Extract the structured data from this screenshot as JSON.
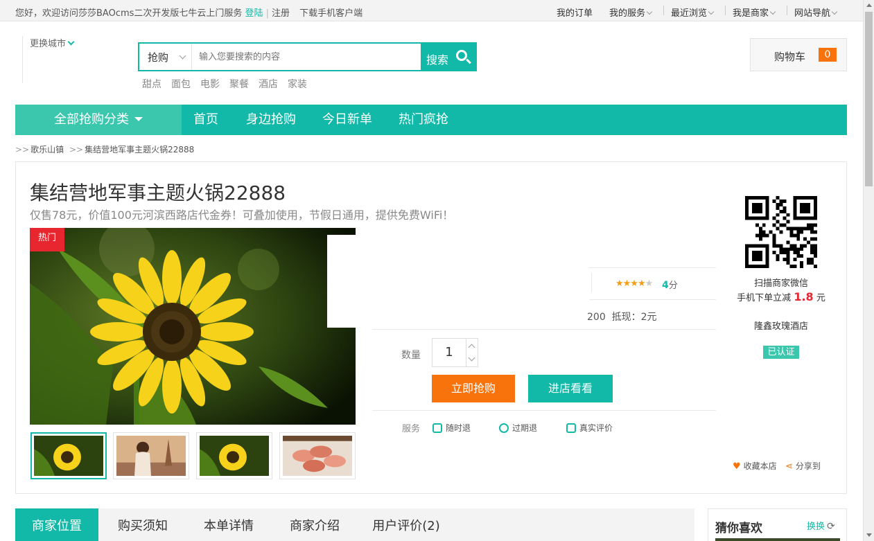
{
  "topbar": {
    "greeting": "您好，欢迎访问莎莎BAOcms二次开发版七牛云上门服务",
    "login": "登陆",
    "register": "注册",
    "download": "下载手机客户端",
    "my_orders": "我的订单",
    "my_services": "我的服务",
    "recent": "最近浏览",
    "merchant": "我是商家",
    "site_nav": "网站导航"
  },
  "header": {
    "change_city": "更换城市",
    "search_type": "抢购",
    "search_placeholder": "输入您要搜索的内容",
    "search_button": "搜索",
    "hot_words": [
      "甜点",
      "面包",
      "电影",
      "聚餐",
      "酒店",
      "家装"
    ],
    "cart_label": "购物车",
    "cart_count": "0"
  },
  "nav": {
    "all_categories": "全部抢购分类",
    "items": [
      "首页",
      "身边抢购",
      "今日新单",
      "热门疯抢"
    ]
  },
  "breadcrumb": {
    "items": [
      "歌乐山镇",
      "集结营地军事主题火锅22888"
    ]
  },
  "product": {
    "title": "集结营地军事主题火锅22888",
    "subtitle": "仅售78元，价值100元河滨西路店代金券！可叠加使用，节假日通用，提供免费WiFi！",
    "hot_tag": "热门",
    "rating_stars": 4,
    "rating_text": "4",
    "rating_unit": "分",
    "cash_partial": "200",
    "cash_label": "抵现：",
    "cash_value": "2元",
    "qty_label": "数量",
    "qty_value": "1",
    "buy_button": "立即抢购",
    "shop_button": "进店看看",
    "service_label": "服务",
    "services": [
      "随时退",
      "过期退",
      "真实评价"
    ]
  },
  "sidebar": {
    "scan_text": "扫描商家微信",
    "mobile_discount_prefix": "手机下单立减",
    "mobile_discount_value": "1.8",
    "mobile_discount_unit": "元",
    "merchant_name": "隆鑫玫瑰酒店",
    "verified": "已认证",
    "favorite": "收藏本店",
    "share": "分享到"
  },
  "tabs": {
    "items": [
      "商家位置",
      "购买须知",
      "本单详情",
      "商家介绍",
      "用户评价(2)"
    ],
    "active": 0
  },
  "guess": {
    "title": "猜你喜欢",
    "refresh": "换换"
  },
  "colors": {
    "accent": "#12b9a8",
    "accent_light": "#3bc6ae",
    "orange": "#f8730c",
    "red": "#e7262f"
  }
}
